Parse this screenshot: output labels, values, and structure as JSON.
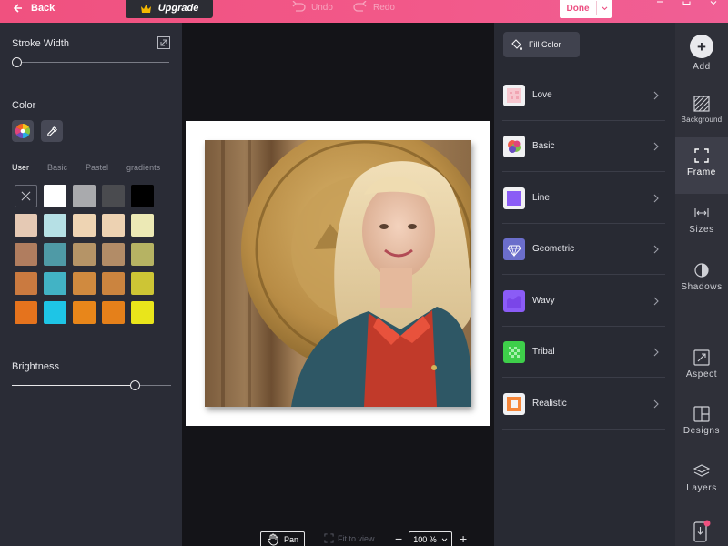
{
  "topbar": {
    "back_label": "Back",
    "upgrade_label": "Upgrade",
    "undo_label": "Undo",
    "redo_label": "Redo",
    "done_label": "Done"
  },
  "left_panel": {
    "stroke_width_label": "Stroke Width",
    "stroke_width_value": 0,
    "color_label": "Color",
    "palette_tabs": [
      "User",
      "Basic",
      "Pastel",
      "gradients"
    ],
    "active_palette_tab": "User",
    "swatches": [
      "none",
      "#ffffff",
      "#a9aaad",
      "#4a4b4f",
      "#000000",
      "#e5c9b4",
      "#b6e0e5",
      "#eed4b3",
      "#edd2b2",
      "#ece9b5",
      "#b07d5f",
      "#4f9aa6",
      "#b59467",
      "#b28c67",
      "#b6b363",
      "#ca7a40",
      "#42b3c5",
      "#d08a3f",
      "#cb843f",
      "#cdc535",
      "#e5731d",
      "#1ec5e6",
      "#e8861a",
      "#e5801a",
      "#e9e51b",
      "#b54f12",
      "#0b93b7",
      "#b8600e",
      "#b35d10",
      "#a8a210"
    ],
    "brightness_label": "Brightness",
    "brightness_value": 0.77
  },
  "canvas": {
    "pan_label": "Pan",
    "fit_label": "Fit to view",
    "zoom_value": "100 %",
    "zoom_minus": "−",
    "zoom_plus": "+"
  },
  "right_panel": {
    "fill_color_label": "Fill Color",
    "categories": [
      {
        "label": "Love",
        "icon": "love-thumb-icon"
      },
      {
        "label": "Basic",
        "icon": "basic-thumb-icon"
      },
      {
        "label": "Line",
        "icon": "line-thumb-icon"
      },
      {
        "label": "Geometric",
        "icon": "geometric-thumb-icon"
      },
      {
        "label": "Wavy",
        "icon": "wavy-thumb-icon"
      },
      {
        "label": "Tribal",
        "icon": "tribal-thumb-icon"
      },
      {
        "label": "Realistic",
        "icon": "realistic-thumb-icon"
      }
    ]
  },
  "sidebar": {
    "items": [
      {
        "label": "Add"
      },
      {
        "label": "Background"
      },
      {
        "label": "Frame"
      },
      {
        "label": "Sizes"
      },
      {
        "label": "Shadows"
      },
      {
        "label": "Aspect"
      },
      {
        "label": "Designs"
      },
      {
        "label": "Layers"
      }
    ],
    "active_item": "Frame"
  },
  "colors": {
    "accent": "#f0517f",
    "panel": "#2a2c36",
    "canvas_bg": "#141418"
  }
}
